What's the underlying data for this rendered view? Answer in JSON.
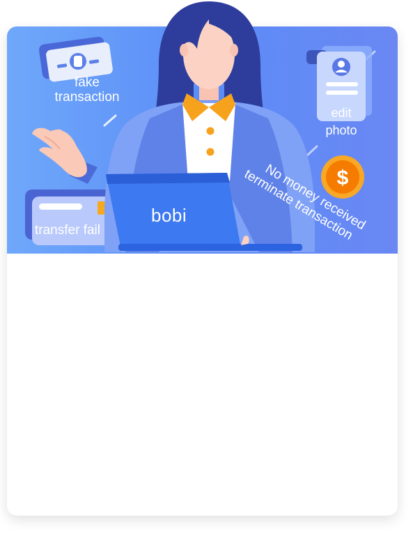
{
  "banner": {
    "labels": {
      "fake_line1": "fake",
      "fake_line2": "transaction",
      "edit_line1": "edit",
      "edit_line2": "photo",
      "transfer": "transfer fail",
      "brand": "bobi",
      "nomoney_line1": "No money received",
      "nomoney_line2": "terminate transaction"
    },
    "icons": [
      "banknote-icon",
      "profile-document-icon",
      "bank-card-icon",
      "dollar-coin-icon",
      "laptop-icon",
      "waving-hand-icon"
    ],
    "colors": {
      "gradient_start": "#6fa8fa",
      "gradient_end": "#6a87f3",
      "hair": "#2f3c9e",
      "collar": "#f5a623",
      "coin": "#f6a01a",
      "laptop": "#3d7bf2"
    }
  }
}
